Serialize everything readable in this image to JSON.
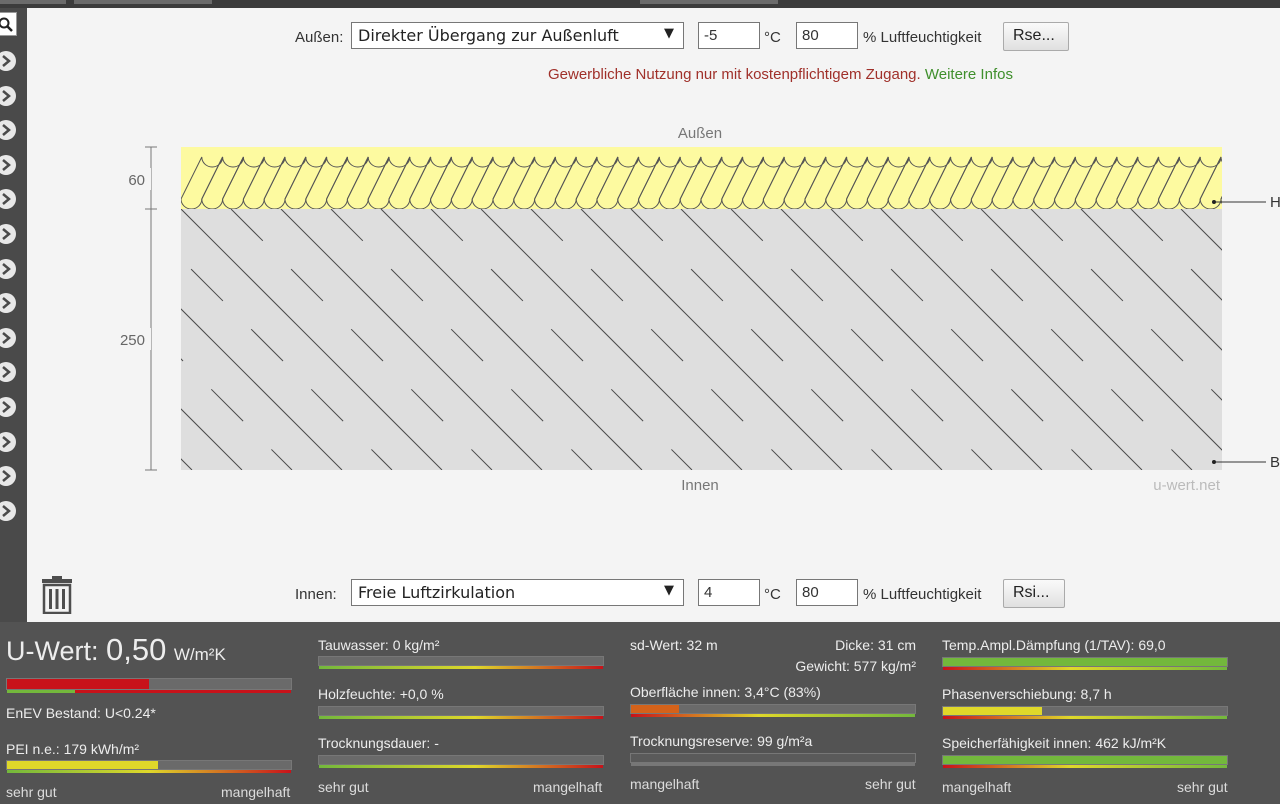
{
  "outside": {
    "label": "Außen:",
    "transition": "Direkter Übergang zur Außenluft",
    "temperature": "-5",
    "temp_unit": "°C",
    "humidity": "80",
    "humidity_label": "% Luftfeuchtigkeit",
    "button": "Rse..."
  },
  "inside": {
    "label": "Innen:",
    "transition": "Freie Luftzirkulation",
    "temperature": "4",
    "temp_unit": "°C",
    "humidity": "80",
    "humidity_label": "% Luftfeuchtigkeit",
    "button": "Rsi..."
  },
  "notice": {
    "text": "Gewerbliche Nutzung nur mit kostenpflichtigem Zugang.",
    "link": "Weitere Infos"
  },
  "diagram": {
    "top_label": "Außen",
    "bottom_label": "Innen",
    "watermark": "u-wert.net",
    "layers": [
      {
        "thickness": "60",
        "callout": "H",
        "color": "#fdfaa0"
      },
      {
        "thickness": "250",
        "callout": "B",
        "color": "#dedede"
      }
    ]
  },
  "results": {
    "uwert": {
      "label": "U-Wert:",
      "value": "0,50",
      "unit": "W/m²K",
      "level": 0.5
    },
    "enev": "EnEV Bestand: U<0.24*",
    "pei": {
      "label": "PEI n.e.: 179 kWh/m²",
      "level": 0.53
    },
    "tauwasser": {
      "label": "Tauwasser: 0 kg/m²",
      "level": 0.0
    },
    "holzfeuchte": {
      "label": "Holzfeuchte: +0,0 %",
      "level": 0.0
    },
    "trocknungsdauer": {
      "label": "Trocknungsdauer: -",
      "level": 0.0
    },
    "sdwert": "sd-Wert: 32 m",
    "dicke": "Dicke: 31 cm",
    "gewicht": "Gewicht: 577 kg/m²",
    "oberflaeche": {
      "label": "Oberfläche innen: 3,4°C (83%)",
      "level": 0.17
    },
    "trocknungsreserve": {
      "label": "Trocknungsreserve: 99 g/m²a",
      "level": 0.0
    },
    "tav": {
      "label": "Temp.Ampl.Dämpfung (1/TAV): 69,0",
      "level": 1.0
    },
    "phase": {
      "label": "Phasenverschiebung: 8,7 h",
      "level": 0.35
    },
    "speicher": {
      "label": "Speicherfähigkeit innen: 462 kJ/m²K",
      "level": 1.0
    }
  },
  "scales": {
    "good": "sehr gut",
    "bad": "mangelhaft"
  },
  "colors": {
    "red": "#c8121a",
    "yellow": "#dfd82a",
    "green": "#73b83c",
    "orange": "#d4621a"
  },
  "icons": {
    "sidebar_top": "search-icon",
    "sidebar_items": "chevron-right-icon",
    "delete": "trash-icon"
  }
}
